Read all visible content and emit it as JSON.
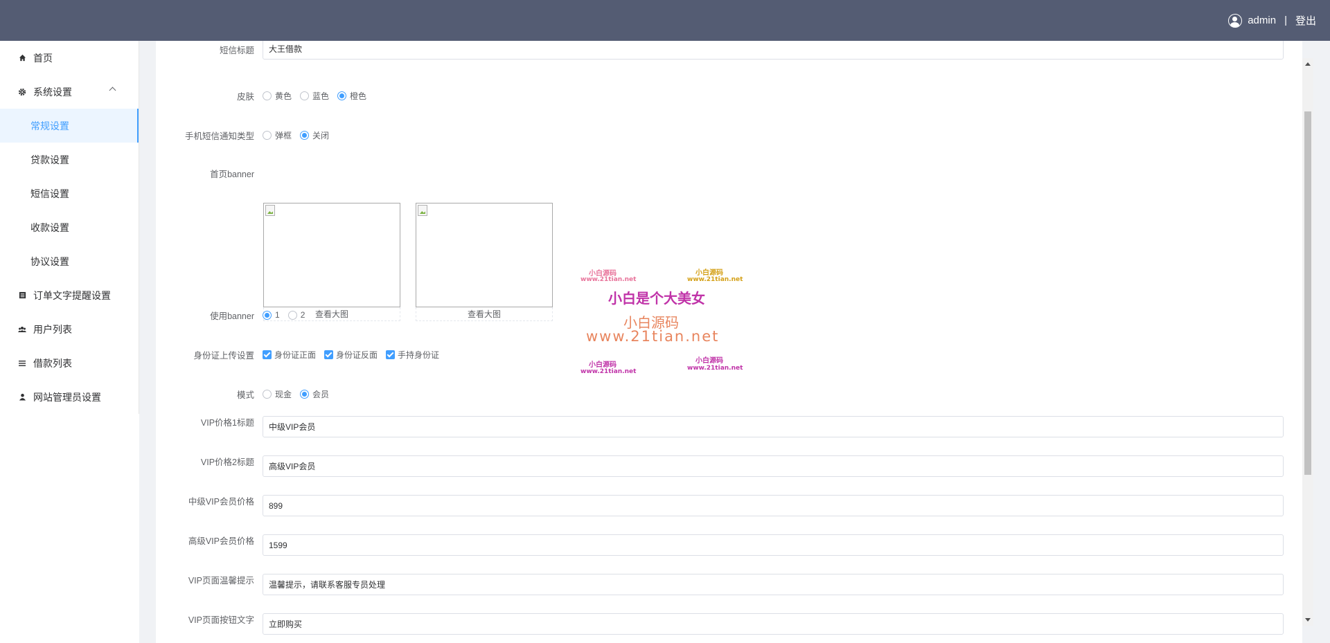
{
  "header": {
    "username": "admin",
    "separator": "|",
    "logout_label": "登出"
  },
  "sidebar": {
    "items": [
      {
        "label": "首页",
        "icon": "home-icon"
      },
      {
        "label": "系统设置",
        "icon": "gear-icon",
        "expanded": true
      },
      {
        "label": "订单文字提醒设置",
        "icon": "list-icon"
      },
      {
        "label": "用户列表",
        "icon": "users-icon"
      },
      {
        "label": "借款列表",
        "icon": "menu-lines-icon"
      },
      {
        "label": "网站管理员设置",
        "icon": "user-icon"
      }
    ],
    "sub_items": [
      {
        "label": "常规设置",
        "active": true
      },
      {
        "label": "贷款设置"
      },
      {
        "label": "短信设置"
      },
      {
        "label": "收款设置"
      },
      {
        "label": "协议设置"
      }
    ]
  },
  "form": {
    "partial_top": {
      "label": "短信标题",
      "value": "大王借款"
    },
    "skin": {
      "label": "皮肤",
      "options": [
        "黄色",
        "蓝色",
        "橙色"
      ],
      "selected": "橙色"
    },
    "sms_notice": {
      "label": "手机短信通知类型",
      "options": [
        "弹框",
        "关闭"
      ],
      "selected": "关闭"
    },
    "banner": {
      "label": "首页banner",
      "view_label": "查看大图"
    },
    "use_banner": {
      "label": "使用banner",
      "options": [
        "1",
        "2"
      ],
      "selected": "1"
    },
    "id_upload": {
      "label": "身份证上传设置",
      "options": [
        "身份证正面",
        "身份证反面",
        "手持身份证"
      ],
      "checked": [
        "身份证正面",
        "身份证反面",
        "手持身份证"
      ]
    },
    "mode": {
      "label": "模式",
      "options": [
        "现金",
        "会员"
      ],
      "selected": "会员"
    },
    "vip1_title": {
      "label": "VIP价格1标题",
      "value": "中级VIP会员"
    },
    "vip2_title": {
      "label": "VIP价格2标题",
      "value": "高级VIP会员"
    },
    "mid_price": {
      "label": "中级VIP会员价格",
      "value": "899"
    },
    "high_price": {
      "label": "高级VIP会员价格",
      "value": "1599"
    },
    "vip_tip": {
      "label": "VIP页面温馨提示",
      "value": "温馨提示，请联系客服专员处理"
    },
    "vip_btn": {
      "label": "VIP页面按钮文字",
      "value": "立即购买"
    }
  },
  "watermark": {
    "small_1": "小白源码",
    "url_1": "www.21tian.net",
    "small_2": "小白源码",
    "url_2": "www.21tian.net",
    "headline": "小白是个大美女",
    "brand": "小白源码",
    "url_big": "www.21tian.net",
    "small_3": "小白源码",
    "url_3": "www.21tian.net",
    "small_4": "小白源码",
    "url_4": "www.21tian.net"
  },
  "colors": {
    "topbar": "#545c73",
    "accent": "#409eff",
    "active_bg": "#ecf5ff"
  }
}
